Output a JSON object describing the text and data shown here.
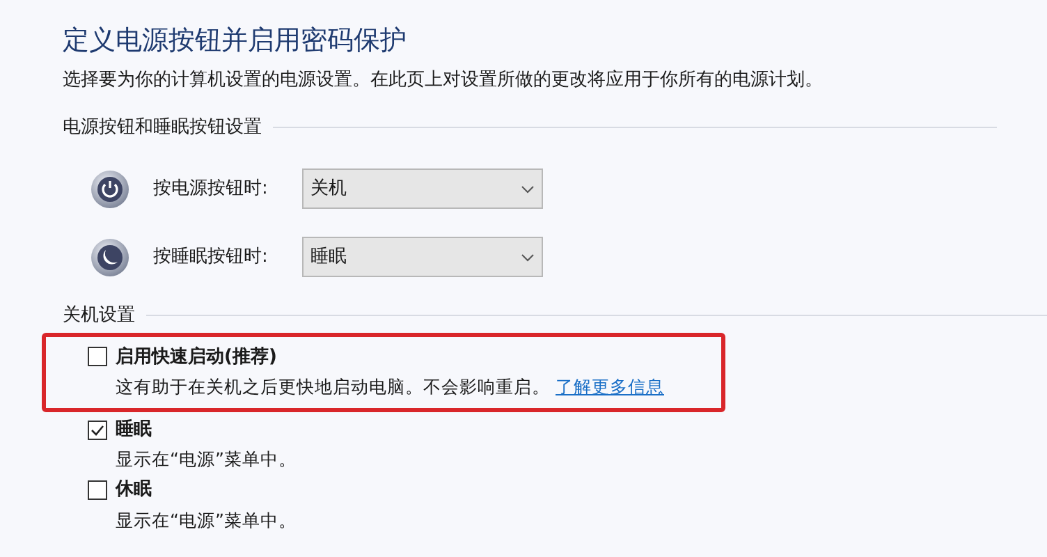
{
  "title": "定义电源按钮并启用密码保护",
  "description": "选择要为你的计算机设置的电源设置。在此页上对设置所做的更改将应用于你所有的电源计划。",
  "button_section": {
    "heading": "电源按钮和睡眠按钮设置",
    "rows": [
      {
        "kind": "power",
        "label": "按电源按钮时:",
        "value": "关机"
      },
      {
        "kind": "sleep",
        "label": "按睡眠按钮时:",
        "value": "睡眠"
      }
    ]
  },
  "shutdown_section": {
    "heading": "关机设置",
    "options": [
      {
        "label": "启用快速启动(推荐)",
        "checked": false,
        "highlighted": true,
        "description": "这有助于在关机之后更快地启动电脑。不会影响重启。",
        "link": "了解更多信息"
      },
      {
        "label": "睡眠",
        "checked": true,
        "highlighted": false,
        "description": "显示在“电源”菜单中。"
      },
      {
        "label": "休眠",
        "checked": false,
        "highlighted": false,
        "description": "显示在“电源”菜单中。"
      }
    ]
  }
}
